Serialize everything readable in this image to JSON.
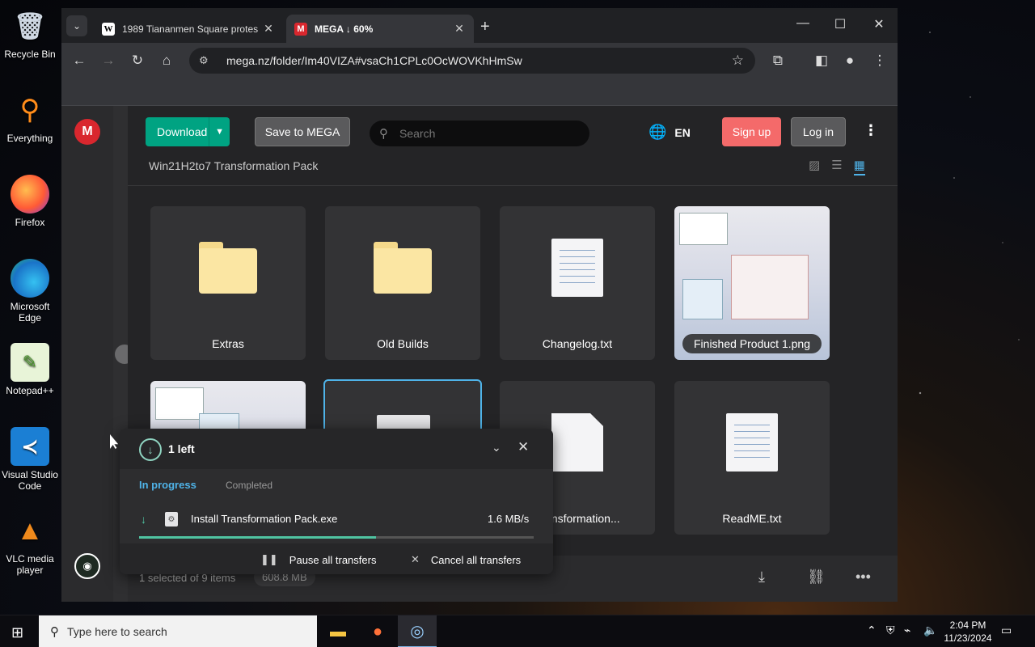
{
  "desktop": {
    "icons": [
      {
        "label": "Recycle Bin",
        "icon": "recycle-bin-icon"
      },
      {
        "label": "Everything",
        "icon": "everything-search-icon"
      },
      {
        "label": "Firefox",
        "icon": "firefox-icon"
      },
      {
        "label": "Microsoft Edge",
        "icon": "edge-icon"
      },
      {
        "label": "Notepad++",
        "icon": "notepadpp-icon"
      },
      {
        "label": "Visual Studio Code",
        "icon": "vscode-icon"
      },
      {
        "label": "VLC media player",
        "icon": "vlc-icon"
      }
    ]
  },
  "browser": {
    "tabs": [
      {
        "title": "1989 Tiananmen Square protes",
        "favicon": "W"
      },
      {
        "title": "MEGA ↓ 60%",
        "favicon": "M"
      }
    ],
    "url": "mega.nz/folder/Im40VIZA#vsaCh1CPLc0OcWOVKhHmSw"
  },
  "mega": {
    "download_label": "Download",
    "save_label": "Save to MEGA",
    "search_placeholder": "Search",
    "language": "EN",
    "signup_label": "Sign up",
    "login_label": "Log in",
    "folder_title": "Win21H2to7 Transformation Pack",
    "items": [
      {
        "name": "Extras",
        "type": "folder"
      },
      {
        "name": "Old Builds",
        "type": "folder"
      },
      {
        "name": "Changelog.txt",
        "type": "text"
      },
      {
        "name": "Finished Product 1.png",
        "type": "image"
      },
      {
        "name": "",
        "type": "image"
      },
      {
        "name": "",
        "type": "exe"
      },
      {
        "name": "Transformation...",
        "type": "blank"
      },
      {
        "name": "ReadME.txt",
        "type": "text"
      }
    ],
    "footer": {
      "selection_count": "1 selected of 9 items",
      "selection_size": "608.8 MB"
    }
  },
  "transfer": {
    "remaining": "1 left",
    "tab_in_progress": "In progress",
    "tab_completed": "Completed",
    "file_name": "Install Transformation Pack.exe",
    "speed": "1.6 MB/s",
    "progress_percent": 60,
    "pause_label": "Pause all transfers",
    "cancel_label": "Cancel all transfers"
  },
  "taskbar": {
    "search_placeholder": "Type here to search",
    "time": "2:04 PM",
    "date": "11/23/2024"
  }
}
